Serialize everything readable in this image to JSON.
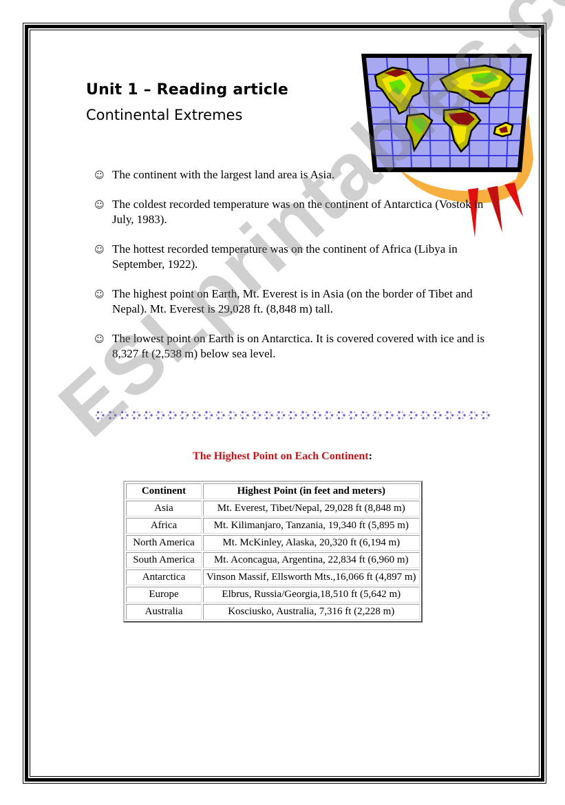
{
  "document": {
    "title": "Unit 1 – Reading article",
    "subtitle": "Continental Extremes",
    "illustration": "world-map-clipart",
    "bullet_icon": "smiley-face-icon",
    "bullet_glyph": "☺",
    "facts": [
      "The continent with the largest land area is Asia.",
      "The coldest recorded temperature was on the continent of Antarctica (Vostok in July, 1983).",
      "The hottest recorded temperature was on the continent of Africa (Libya in September, 1922).",
      "The highest point on Earth, Mt. Everest is in Asia (on the border of Tibet and Nepal). Mt. Everest is 29,028 ft. (8,848 m) tall.",
      "The lowest point on Earth is on Antarctica. It is covered covered with ice and is 8,327 ft (2,538 m) below sea level."
    ],
    "divider": "decorative-dotted-circles",
    "table_title": "The Highest Point on Each Continent",
    "table_title_suffix": ":",
    "table": {
      "headers": [
        "Continent",
        "Highest Point (in feet and meters)"
      ],
      "rows": [
        [
          "Asia",
          "Mt. Everest, Tibet/Nepal, 29,028 ft (8,848 m)"
        ],
        [
          "Africa",
          "Mt. Kilimanjaro, Tanzania, 19,340 ft (5,895 m)"
        ],
        [
          "North America",
          "Mt. McKinley, Alaska, 20,320 ft (6,194 m)"
        ],
        [
          "South America",
          "Mt. Aconcagua, Argentina, 22,834 ft (6,960 m)"
        ],
        [
          "Antarctica",
          "Vinson Massif, Ellsworth Mts.,16,066 ft (4,897 m)"
        ],
        [
          "Europe",
          "Elbrus, Russia/Georgia,18,510 ft (5,642 m)"
        ],
        [
          "Australia",
          "Kosciusko, Australia, 7,316 ft (2,228 m)"
        ]
      ]
    },
    "watermark": "ESLprintables.com"
  },
  "colors": {
    "table_title_red": "#c0161b",
    "map_ocean": "#a8a8f0",
    "map_grid": "#3a3ae0",
    "map_land_yellow": "#f5e600",
    "map_land_olive": "#b8b800",
    "map_land_green": "#66e000",
    "map_land_brown": "#8a1010",
    "map_swoosh_orange": "#f7b040",
    "map_spikes_red": "#e01010",
    "divider_purple": "#6a4ad0"
  }
}
